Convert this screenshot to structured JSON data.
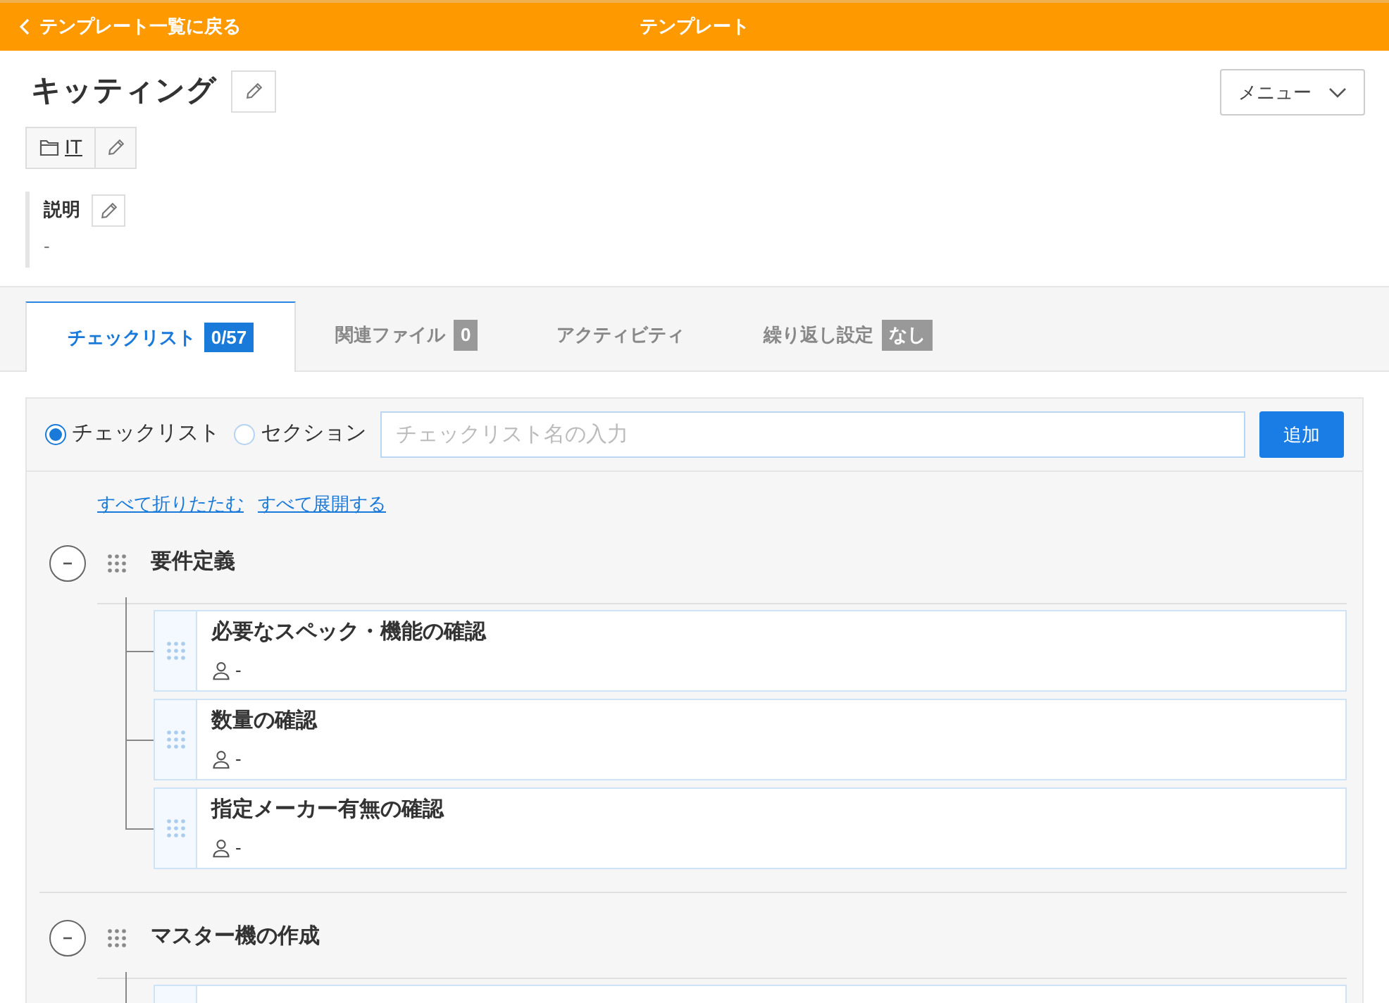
{
  "top_bar": {
    "back_link": "テンプレート一覧に戻る",
    "title": "テンプレート"
  },
  "template": {
    "name": "キッティング",
    "category": "IT",
    "description_label": "説明",
    "description": "-",
    "menu_button": "メニュー"
  },
  "tabs": [
    {
      "label": "チェックリスト",
      "badge": "0/57",
      "selected": true
    },
    {
      "label": "関連ファイル",
      "badge": "0",
      "selected": false
    },
    {
      "label": "アクティビティ",
      "selected": false
    },
    {
      "label": "繰り返し設定",
      "badge": "なし",
      "selected": false
    }
  ],
  "add_form": {
    "types": [
      {
        "label": "チェックリスト",
        "selected": true
      },
      {
        "label": "セクション",
        "selected": false
      }
    ],
    "placeholder": "チェックリスト名の入力",
    "button": "追加"
  },
  "links": [
    "すべて折りたたむ",
    "すべて展開する"
  ],
  "sections": [
    {
      "title": "要件定義",
      "expanded": true,
      "items": [
        {
          "title": "必要なスペック・機能の確認",
          "assignee": "-"
        },
        {
          "title": "数量の確認",
          "assignee": "-"
        },
        {
          "title": "指定メーカー有無の確認",
          "assignee": "-"
        }
      ]
    },
    {
      "title": "マスター機の作成",
      "expanded": true
    }
  ]
}
